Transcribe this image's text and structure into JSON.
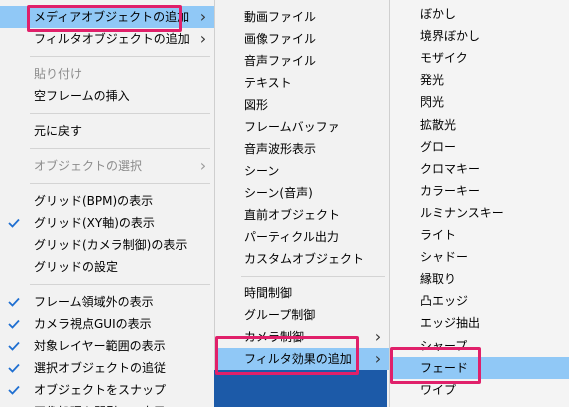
{
  "menu1": {
    "items": [
      {
        "label": "メディアオブジェクトの追加",
        "submenu": true,
        "highlighted": true
      },
      {
        "label": "フィルタオブジェクトの追加",
        "submenu": true
      },
      {
        "sep": true
      },
      {
        "label": "貼り付け",
        "disabled": true
      },
      {
        "label": "空フレームの挿入"
      },
      {
        "sep": true
      },
      {
        "label": "元に戻す"
      },
      {
        "sep": true
      },
      {
        "label": "オブジェクトの選択",
        "disabled": true,
        "submenu": true
      },
      {
        "sep": true
      },
      {
        "label": "グリッド(BPM)の表示"
      },
      {
        "label": "グリッド(XY軸)の表示",
        "checked": true
      },
      {
        "label": "グリッド(カメラ制御)の表示"
      },
      {
        "label": "グリッドの設定"
      },
      {
        "sep": true
      },
      {
        "label": "フレーム領域外の表示",
        "checked": true
      },
      {
        "label": "カメラ視点GUIの表示",
        "checked": true
      },
      {
        "label": "対象レイヤー範囲の表示",
        "checked": true
      },
      {
        "label": "選択オブジェクトの追従",
        "checked": true
      },
      {
        "label": "オブジェクトをスナップ",
        "checked": true
      },
      {
        "label": "画像処理を間引いて表示"
      }
    ]
  },
  "menu2": {
    "items": [
      {
        "label": "動画ファイル"
      },
      {
        "label": "画像ファイル"
      },
      {
        "label": "音声ファイル"
      },
      {
        "label": "テキスト"
      },
      {
        "label": "図形"
      },
      {
        "label": "フレームバッファ"
      },
      {
        "label": "音声波形表示"
      },
      {
        "label": "シーン"
      },
      {
        "label": "シーン(音声)"
      },
      {
        "label": "直前オブジェクト"
      },
      {
        "label": "パーティクル出力"
      },
      {
        "label": "カスタムオブジェクト"
      },
      {
        "sep": true
      },
      {
        "label": "時間制御"
      },
      {
        "label": "グループ制御"
      },
      {
        "label": "カメラ制御",
        "submenu": true
      },
      {
        "label": "フィルタ効果の追加",
        "submenu": true,
        "highlighted": true
      }
    ]
  },
  "menu3": {
    "items": [
      {
        "label": "ぼかし"
      },
      {
        "label": "境界ぼかし"
      },
      {
        "label": "モザイク"
      },
      {
        "label": "発光"
      },
      {
        "label": "閃光"
      },
      {
        "label": "拡散光"
      },
      {
        "label": "グロー"
      },
      {
        "label": "クロマキー"
      },
      {
        "label": "カラーキー"
      },
      {
        "label": "ルミナンスキー"
      },
      {
        "label": "ライト"
      },
      {
        "label": "シャドー"
      },
      {
        "label": "縁取り"
      },
      {
        "label": "凸エッジ"
      },
      {
        "label": "エッジ抽出"
      },
      {
        "label": "シャープ"
      },
      {
        "label": "フェード",
        "highlighted": true
      },
      {
        "label": "ワイプ"
      }
    ]
  },
  "colors": {
    "highlight": "#90c8f6",
    "callout": "#e0206a",
    "check": "#1f6fd1",
    "disabled": "#8c8c8c"
  }
}
